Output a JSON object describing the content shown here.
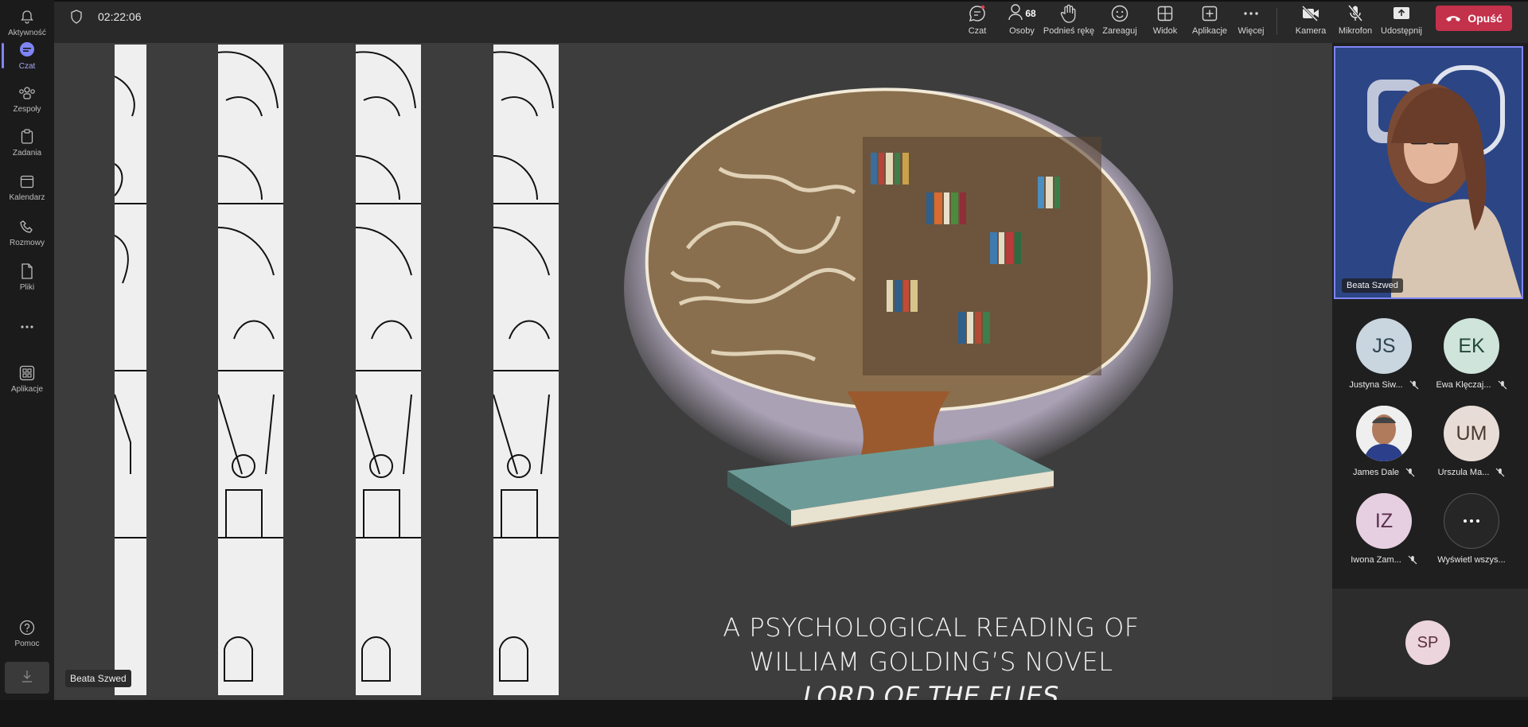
{
  "rail": {
    "items": [
      {
        "label": "Aktywność",
        "icon": "bell-icon"
      },
      {
        "label": "Czat",
        "icon": "chat-icon",
        "active": true
      },
      {
        "label": "Zespoły",
        "icon": "teams-icon"
      },
      {
        "label": "Zadania",
        "icon": "tasks-icon"
      },
      {
        "label": "Kalendarz",
        "icon": "calendar-icon"
      },
      {
        "label": "Rozmowy",
        "icon": "phone-icon"
      },
      {
        "label": "Pliki",
        "icon": "file-icon"
      },
      {
        "label": "",
        "icon": "more-icon"
      },
      {
        "label": "Aplikacje",
        "icon": "apps-icon"
      }
    ],
    "help_label": "Pomoc"
  },
  "topbar": {
    "timer": "02:22:06",
    "chat": "Czat",
    "people": "Osoby",
    "people_count": "68",
    "raise_hand": "Podnieś rękę",
    "react": "Zareaguj",
    "view": "Widok",
    "apps": "Aplikacje",
    "more": "Więcej",
    "camera": "Kamera",
    "mic": "Mikrofon",
    "share": "Udostępnij",
    "leave": "Opuść"
  },
  "slide": {
    "title_line1": "A PSYCHOLOGICAL READING OF",
    "title_line2": "WILLIAM GOLDING’S NOVEL",
    "title_line3": "LORD OF THE FLIES"
  },
  "presenter_tag": "Beata Szwed",
  "video": {
    "name": "Beata Szwed"
  },
  "participants": [
    {
      "initials": "JS",
      "name": "Justyna Siw...",
      "bg": "#c9d6e0",
      "fg": "#2f4350"
    },
    {
      "initials": "EK",
      "name": "Ewa Klęczaj...",
      "bg": "#cfe5dc",
      "fg": "#24473a"
    },
    {
      "initials": "",
      "name": "James Dale",
      "bg": "#d8d8d8",
      "fg": "#333"
    },
    {
      "initials": "UM",
      "name": "Urszula Ma...",
      "bg": "#e8ddd6",
      "fg": "#4a3a30"
    },
    {
      "initials": "IZ",
      "name": "Iwona Zam...",
      "bg": "#e6cfe0",
      "fg": "#5a2e4f"
    },
    {
      "initials": "",
      "name": "Wyświetl wszys...",
      "bg": "#2a2a2a",
      "fg": "#ffffff"
    }
  ],
  "sp": {
    "initials": "SP"
  }
}
